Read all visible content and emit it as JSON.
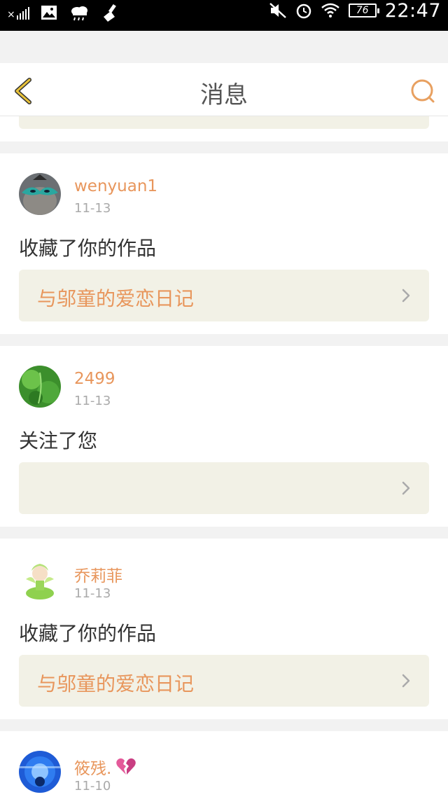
{
  "status_bar": {
    "time": "22:47",
    "battery": "76",
    "colors": {
      "bg": "#000000",
      "fg": "#ffffff"
    }
  },
  "header": {
    "title": "消息",
    "icons": {
      "back": "chevron-left-icon",
      "search": "search-icon"
    },
    "accent": "#e8c23a"
  },
  "notifications": [
    {
      "username": "wenyuan1",
      "date": "11-13",
      "action": "收藏了你的作品",
      "work_title": "与邬童的爱恋日记"
    },
    {
      "username": "2499",
      "date": "11-13",
      "action": "关注了您",
      "work_title": ""
    },
    {
      "username": "乔莉菲",
      "date": "11-13",
      "action": "收藏了你的作品",
      "work_title": "与邬童的爱恋日记"
    },
    {
      "username": "筱残.",
      "date": "11-10",
      "badge_icon": "broken-heart-icon",
      "action": "",
      "work_title": ""
    }
  ],
  "colors": {
    "username": "#e8965c",
    "date": "#aaaaaa",
    "work_bg": "#f2f1e6",
    "page_bg": "#f2f2f2"
  }
}
